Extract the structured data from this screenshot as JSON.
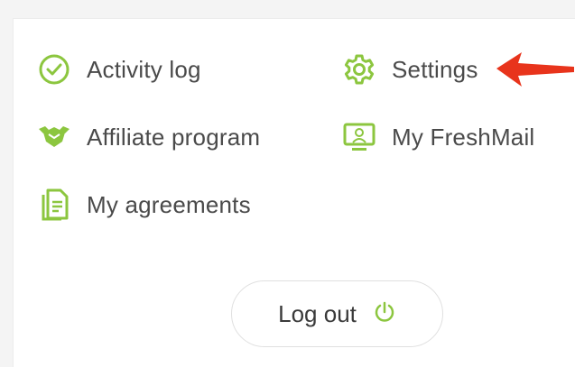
{
  "menu": {
    "items": [
      {
        "label": "Activity log",
        "icon": "check-circle-icon"
      },
      {
        "label": "Settings",
        "icon": "gear-icon"
      },
      {
        "label": "Affiliate program",
        "icon": "handshake-icon"
      },
      {
        "label": "My FreshMail",
        "icon": "monitor-icon"
      },
      {
        "label": "My agreements",
        "icon": "document-icon"
      }
    ]
  },
  "logout": {
    "label": "Log out",
    "icon": "power-icon"
  },
  "colors": {
    "accent": "#8cc63f",
    "arrow": "#e8341c",
    "text": "#4a4a4a"
  }
}
